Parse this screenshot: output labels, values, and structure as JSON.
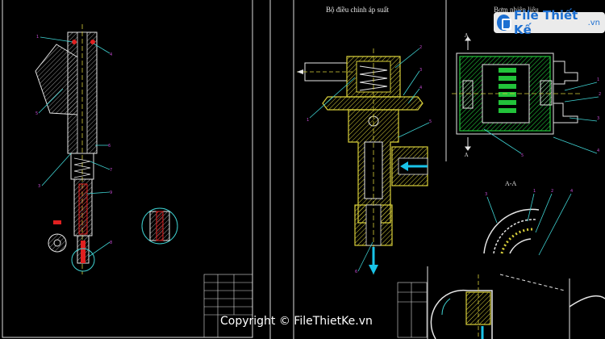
{
  "sheet": {
    "title_pressure_regulator": "Bộ điều chỉnh áp suất",
    "title_right": "Bơm nhiên liệu",
    "section_label": "A-A"
  },
  "watermark": {
    "logo_text": "File Thiết Kế",
    "logo_ext": ".vn",
    "copyright": "Copyright © FileThietKe.vn"
  },
  "colors": {
    "background": "#000000",
    "outline": "#e6e6e6",
    "hatch": "#d8cf3a",
    "leader": "#3fd3d3",
    "red_parts": "#e02020",
    "green_motor": "#22c33a",
    "flow_arrow": "#19c3e8",
    "callout_number": "#c54bd3"
  },
  "icons": [
    "fuel-injector-drawing",
    "pressure-regulator-drawing",
    "fuel-pump-drawing",
    "flow-arrow-icon",
    "logo-icon"
  ]
}
